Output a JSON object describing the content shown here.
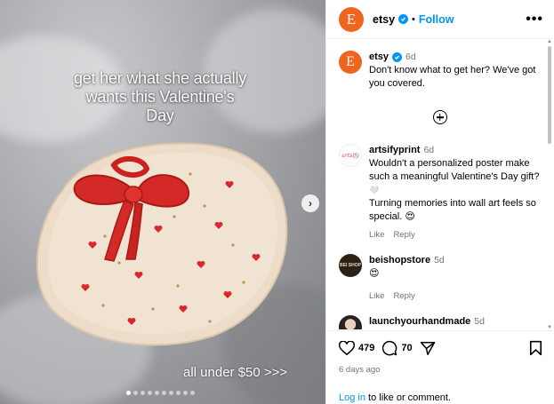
{
  "post": {
    "overlay_text": "get her what she actually wants this Valentine's Day",
    "overlay_subtext": "all under $50 >>>",
    "carousel_count": 10,
    "carousel_active": 0
  },
  "header": {
    "logo_letter": "E",
    "username": "etsy",
    "separator": "•",
    "follow_label": "Follow",
    "more_label": "•••"
  },
  "caption": {
    "username": "etsy",
    "time": "6d",
    "text": "Don't know what to get her? We've got you covered."
  },
  "comments": [
    {
      "username": "artsifyprint",
      "time": "6d",
      "avatar_text": "artsify",
      "lines": [
        "Wouldn't a personalized poster make such a meaningful Valentine's Day gift?",
        "🤍",
        "Turning memories into wall art feels so special. 😍"
      ],
      "like_label": "Like",
      "reply_label": "Reply"
    },
    {
      "username": "beishopstore",
      "time": "5d",
      "avatar_text": "BEI SHOP",
      "lines": [
        "😍"
      ],
      "like_label": "Like",
      "reply_label": "Reply"
    },
    {
      "username": "launchyourhandmade",
      "time": "5d",
      "avatar_text": "",
      "lines": [
        "😍😍"
      ]
    }
  ],
  "footer": {
    "likes": "479",
    "comments": "70",
    "posted": "6 days ago",
    "login_link": "Log in",
    "login_rest": " to like or comment."
  },
  "colors": {
    "brand": "#f1641e",
    "link": "#0095f6",
    "muted": "#737373",
    "heart": "#d9272e"
  }
}
